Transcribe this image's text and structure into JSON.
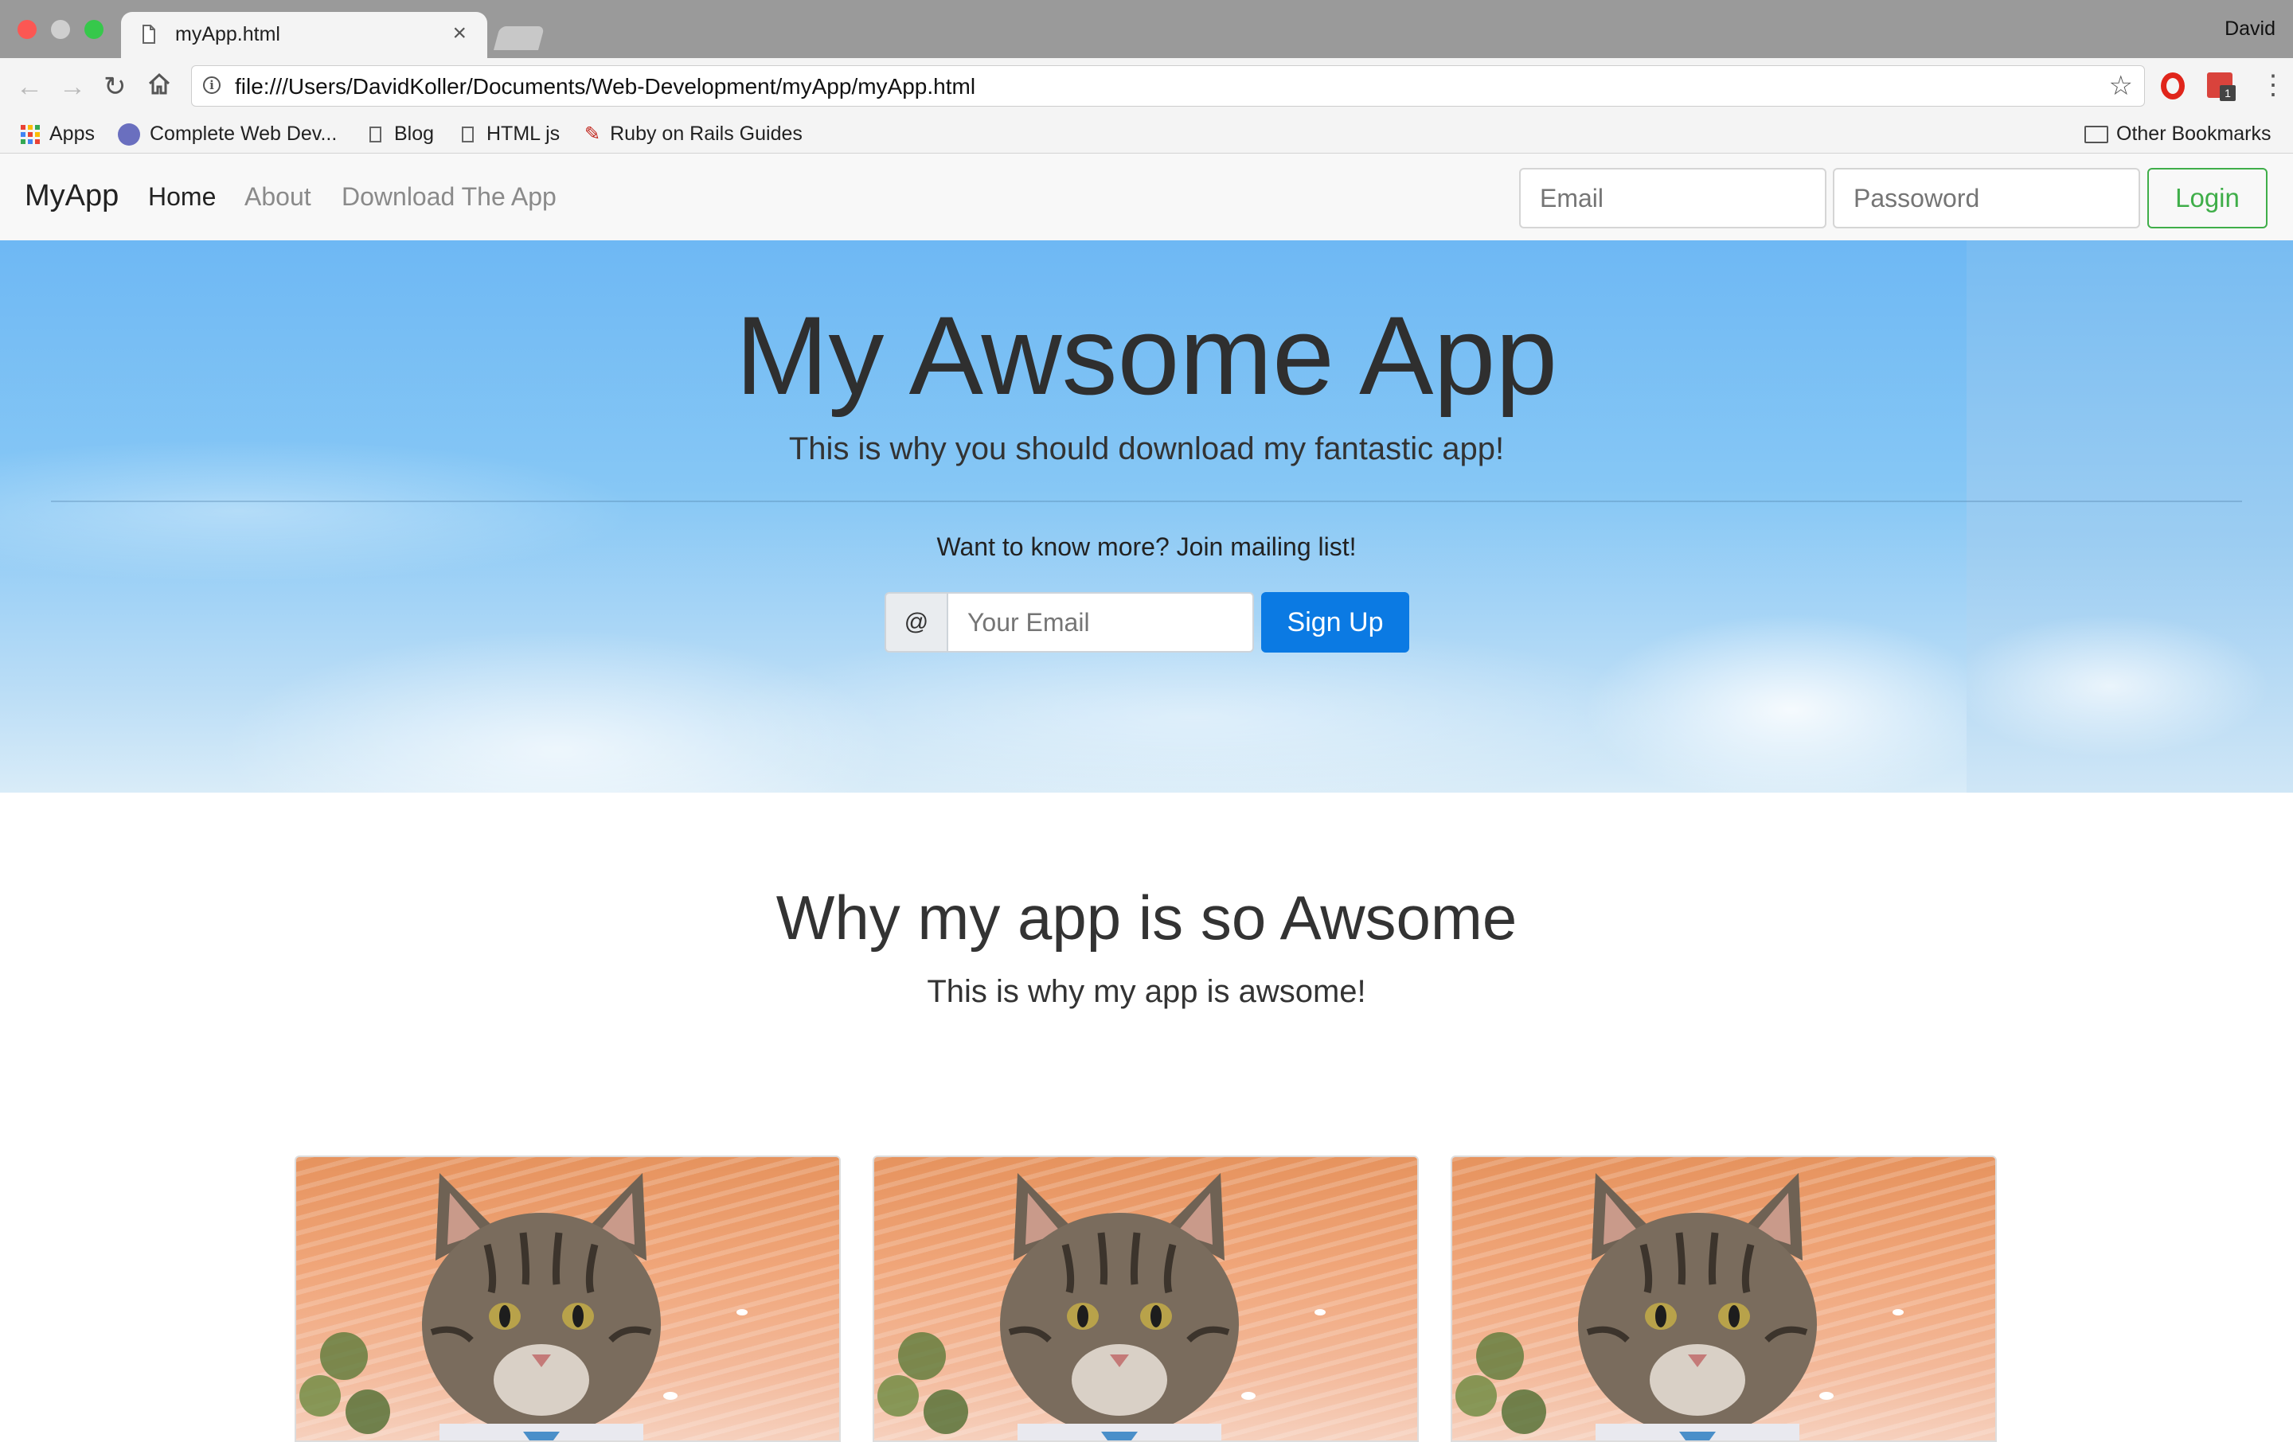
{
  "browser": {
    "tab_title": "myApp.html",
    "tab_close": "×",
    "profile_name": "David",
    "url": "file:///Users/DavidKoller/Documents/Web-Development/myApp/myApp.html",
    "badge_count": "1",
    "bookmarks": [
      "Apps",
      "Complete Web Dev...",
      "Blog",
      "HTML js",
      "Ruby on Rails Guides"
    ],
    "other_bookmarks": "Other Bookmarks"
  },
  "navbar": {
    "brand": "MyApp",
    "links": [
      "Home",
      "About",
      "Download The App"
    ],
    "active_link": "Home",
    "email_placeholder": "Email",
    "password_placeholder": "Passoword",
    "login_label": "Login"
  },
  "hero": {
    "title": "My Awsome App",
    "subtitle": "This is why you should download my fantastic app!",
    "mailing_text": "Want to know more? Join mailing list!",
    "addon": "@",
    "email_placeholder": "Your Email",
    "signup_label": "Sign Up"
  },
  "features": {
    "title": "Why my app is so Awsome",
    "subtitle": "This is why my app is awsome!",
    "card_count": 3
  },
  "colors": {
    "brand_blue": "#0b7ae3",
    "login_green": "#3fae49",
    "sky": "#86c7f5"
  },
  "icons": [
    "file-icon",
    "close-icon",
    "back-icon",
    "forward-icon",
    "reload-icon",
    "home-icon",
    "info-icon",
    "star-icon",
    "opera-icon",
    "calendar-extension-icon",
    "menu-icon",
    "apps-grid-icon",
    "folder-icon",
    "cat-image"
  ]
}
